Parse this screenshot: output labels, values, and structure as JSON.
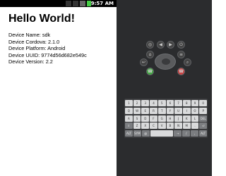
{
  "status_bar": {
    "time": "9:57 AM"
  },
  "app": {
    "title": "Hello World!",
    "info": [
      "Device Name: sdk",
      "Device Cordova: 2.1.0",
      "Device Platform: Android",
      "Device UUID: 9774d56d682e549c",
      "Device Version: 2.2"
    ]
  },
  "emulator": {
    "controls": [
      {
        "name": "camera-button",
        "glyph": "◎"
      },
      {
        "name": "volume-down-button",
        "glyph": "◀"
      },
      {
        "name": "volume-up-button",
        "glyph": "▶"
      },
      {
        "name": "power-button",
        "glyph": "⏻"
      },
      {
        "name": "home-button",
        "glyph": "⌂"
      },
      {
        "name": "menu-button",
        "glyph": "≡"
      },
      {
        "name": "back-button",
        "glyph": "↩"
      },
      {
        "name": "search-button",
        "glyph": "⌕"
      },
      {
        "name": "call-button",
        "glyph": "☎"
      },
      {
        "name": "end-call-button",
        "glyph": "☎"
      }
    ],
    "keyboard_rows": [
      [
        "1",
        "2",
        "3",
        "4",
        "5",
        "6",
        "7",
        "8",
        "9",
        "0"
      ],
      [
        "Q",
        "W",
        "E",
        "R",
        "T",
        "Y",
        "U",
        "I",
        "O",
        "P"
      ],
      [
        "A",
        "S",
        "D",
        "F",
        "G",
        "H",
        "J",
        "K",
        "L",
        "DEL"
      ],
      [
        "⇧",
        "Z",
        "X",
        "C",
        "V",
        "B",
        "N",
        "M",
        ".",
        "⏎"
      ],
      [
        "ALT",
        "SYM",
        "@",
        "SPACE",
        "→",
        "/",
        ",",
        "ALT"
      ]
    ]
  },
  "colors": {
    "call_green": "#4a4",
    "end_call_red": "#c44"
  }
}
